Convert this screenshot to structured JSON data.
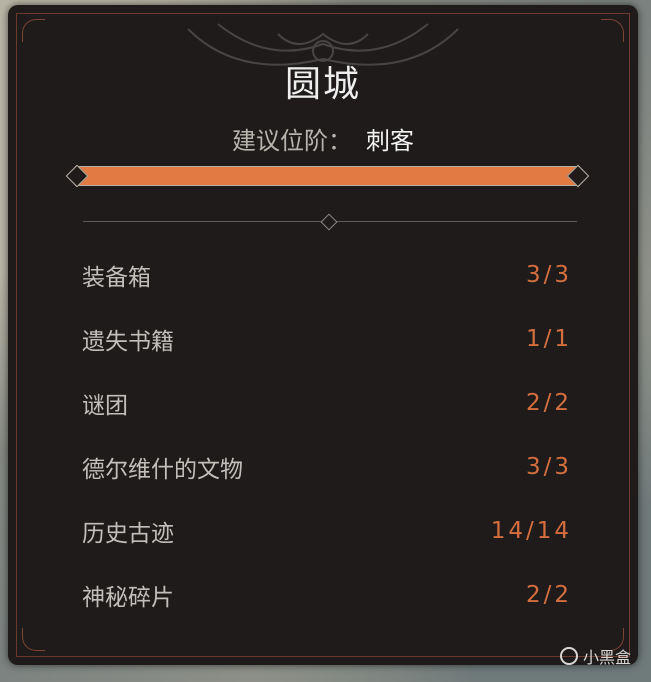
{
  "panel": {
    "title": "圆城",
    "subtitle_label": "建议位阶：",
    "subtitle_value": "刺客",
    "progress": 1.0,
    "accent_color": "#e27a44"
  },
  "items": [
    {
      "label": "装备箱",
      "count": "3/3"
    },
    {
      "label": "遗失书籍",
      "count": "1/1"
    },
    {
      "label": "谜团",
      "count": "2/2"
    },
    {
      "label": "德尔维什的文物",
      "count": "3/3"
    },
    {
      "label": "历史古迹",
      "count": "14/14"
    },
    {
      "label": "神秘碎片",
      "count": "2/2"
    }
  ],
  "watermark": {
    "text": "小黑盒",
    "icon": "heybox-logo-icon"
  }
}
